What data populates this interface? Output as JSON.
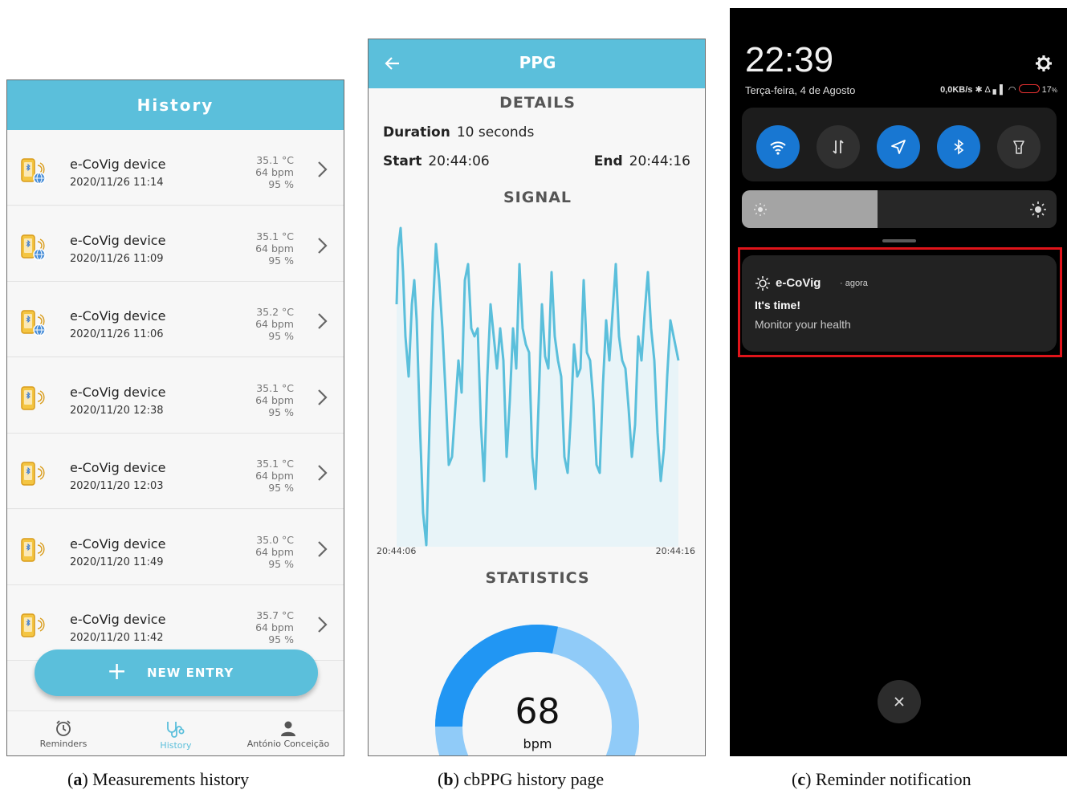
{
  "history": {
    "title": "History",
    "entries": [
      {
        "name": "e-CoVig device",
        "date": "2020/11/26 11:14",
        "temp": "35.1 °C",
        "hr": "64 bpm",
        "spo2": "95 %"
      },
      {
        "name": "e-CoVig device",
        "date": "2020/11/26 11:09",
        "temp": "35.1 °C",
        "hr": "64 bpm",
        "spo2": "95 %"
      },
      {
        "name": "e-CoVig device",
        "date": "2020/11/26 11:06",
        "temp": "35.2 °C",
        "hr": "64 bpm",
        "spo2": "95 %"
      },
      {
        "name": "e-CoVig device",
        "date": "2020/11/20 12:38",
        "temp": "35.1 °C",
        "hr": "64 bpm",
        "spo2": "95 %"
      },
      {
        "name": "e-CoVig device",
        "date": "2020/11/20 12:03",
        "temp": "35.1 °C",
        "hr": "64 bpm",
        "spo2": "95 %"
      },
      {
        "name": "e-CoVig device",
        "date": "2020/11/20 11:49",
        "temp": "35.0 °C",
        "hr": "64 bpm",
        "spo2": "95 %"
      },
      {
        "name": "e-CoVig device",
        "date": "2020/11/20 11:42",
        "temp": "35.7 °C",
        "hr": "64 bpm",
        "spo2": "95 %"
      }
    ],
    "new_entry": "NEW ENTRY",
    "nav": {
      "reminders": "Reminders",
      "history": "History",
      "profile": "António Conceição"
    },
    "accent": "#5bbfdb"
  },
  "ppg": {
    "title": "PPG",
    "details_heading": "DETAILS",
    "duration_label": "Duration",
    "duration_value": "10 seconds",
    "start_label": "Start",
    "start_value": "20:44:06",
    "end_label": "End",
    "end_value": "20:44:16",
    "signal_heading": "SIGNAL",
    "signal_x_start": "20:44:06",
    "signal_x_end": "20:44:16",
    "statistics_heading": "STATISTICS",
    "bpm_value": "68",
    "bpm_unit": "bpm"
  },
  "notification_shade": {
    "time": "22:39",
    "date": "Terça-feira, 4 de Agosto",
    "network_speed": "0,0KB/s",
    "battery": "17",
    "brightness_level": 0.43,
    "notification": {
      "app": "e-CoVig",
      "when": "agora",
      "title": "It's time!",
      "body": "Monitor your health"
    }
  },
  "captions": [
    {
      "letter": "a",
      "text": "Measurements history"
    },
    {
      "letter": "b",
      "text": "cbPPG history page"
    },
    {
      "letter": "c",
      "text": "Reminder notification"
    }
  ]
}
